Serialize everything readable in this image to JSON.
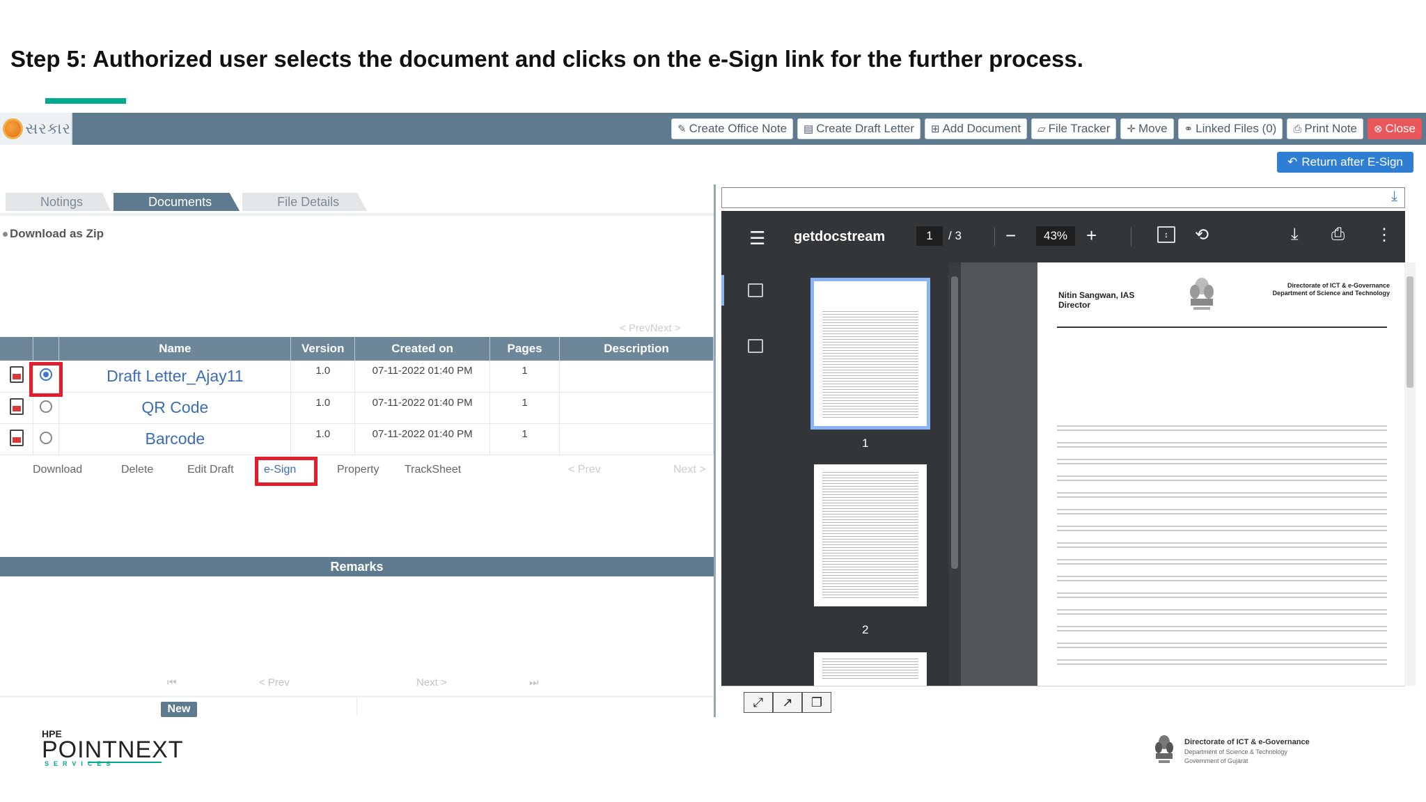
{
  "slide": {
    "title": "Step 5: Authorized user selects the document and clicks on the e-Sign link for the further process."
  },
  "app": {
    "logo_text": "સરકાર",
    "toolbar": [
      {
        "icon": "edit-icon",
        "label": "Create Office Note"
      },
      {
        "icon": "document-icon",
        "label": "Create Draft Letter"
      },
      {
        "icon": "plus-square-icon",
        "label": "Add Document"
      },
      {
        "icon": "folder-icon",
        "label": "File Tracker"
      },
      {
        "icon": "move-icon",
        "label": "Move"
      },
      {
        "icon": "link-icon",
        "label": "Linked Files (0)"
      },
      {
        "icon": "print-icon",
        "label": "Print Note"
      },
      {
        "icon": "close-circle-icon",
        "label": "Close"
      }
    ],
    "return_button": "Return after E-Sign",
    "tabs": [
      "Notings",
      "Documents",
      "File Details"
    ],
    "active_tab": "Documents",
    "download_zip": "Download as Zip",
    "prevnext_top": "< PrevNext >",
    "table": {
      "columns": [
        "Name",
        "Version",
        "Created on",
        "Pages",
        "Description"
      ],
      "rows": [
        {
          "name": "Draft Letter_Ajay11",
          "version": "1.0",
          "created": "07-11-2022 01:40 PM",
          "pages": "1",
          "description": "",
          "selected": true
        },
        {
          "name": "QR Code",
          "version": "1.0",
          "created": "07-11-2022 01:40 PM",
          "pages": "1",
          "description": "",
          "selected": false
        },
        {
          "name": "Barcode",
          "version": "1.0",
          "created": "07-11-2022 01:40 PM",
          "pages": "1",
          "description": "",
          "selected": false
        }
      ]
    },
    "actions": {
      "download": "Download",
      "delete": "Delete",
      "edit_draft": "Edit Draft",
      "esign": "e-Sign",
      "property": "Property",
      "tracksheet": "TrackSheet",
      "prev": "< Prev",
      "next": "Next >"
    },
    "remarks": {
      "title": "Remarks",
      "first": "⏮",
      "prev": "< Prev",
      "next": "Next >",
      "last": "⏭",
      "new_button": "New"
    }
  },
  "pdf_viewer": {
    "file_name": "getdocstream",
    "current_page": "1",
    "total_pages": "/ 3",
    "zoom": "43%",
    "thumbnails": [
      "1",
      "2"
    ],
    "page": {
      "author_name": "Nitin Sangwan, IAS",
      "author_title": "Director",
      "dept_line1": "Directorate of ICT & e-Governance",
      "dept_line2": "Department of Science and Technology"
    }
  },
  "footer": {
    "hpe": "HPE",
    "pointnext": "POINTNEXT",
    "services": "SERVICES",
    "dir_title": "Directorate of ICT & e-Governance",
    "dir_sub1": "Department of Science & Technology",
    "dir_sub2": "Government of Gujarat"
  }
}
